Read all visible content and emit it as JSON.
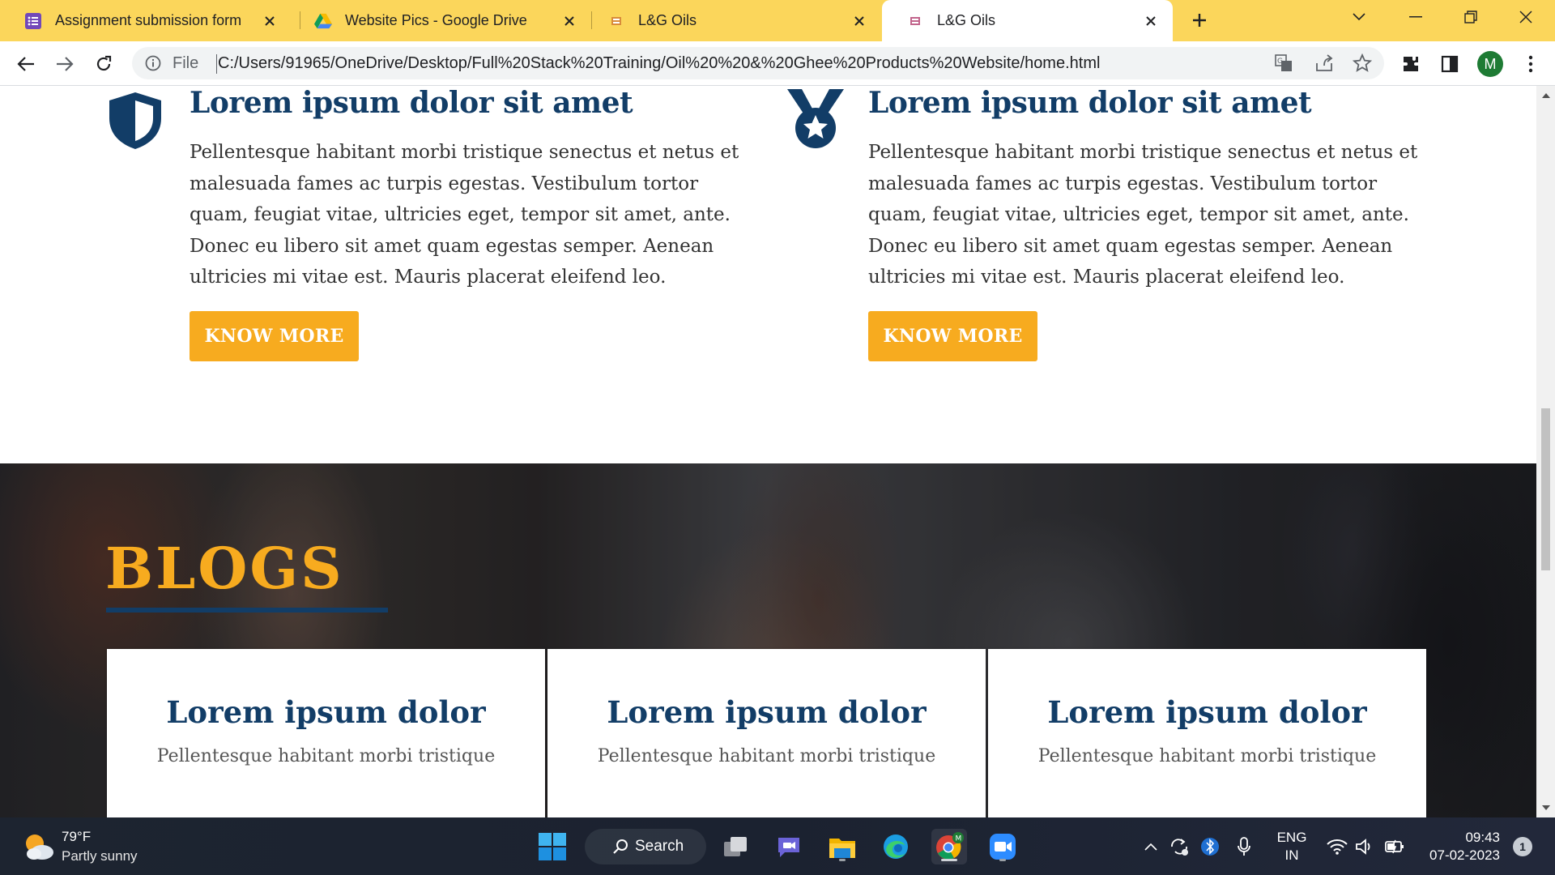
{
  "browser": {
    "tabs": [
      {
        "title": "Assignment submission form",
        "favicon": "google-forms-icon",
        "active": false
      },
      {
        "title": "Website Pics - Google Drive",
        "favicon": "google-drive-icon",
        "active": false
      },
      {
        "title": "L&G Oils",
        "favicon": "site-favicon-icon",
        "active": false
      },
      {
        "title": "L&G Oils",
        "favicon": "site-favicon-icon",
        "active": true
      }
    ],
    "address": {
      "scheme": "File",
      "url": "C:/Users/91965/OneDrive/Desktop/Full%20Stack%20Training/Oil%20%20&%20Ghee%20Products%20Website/home.html"
    },
    "profile_initial": "M"
  },
  "page": {
    "features": [
      {
        "icon": "shield-icon",
        "title": "Lorem ipsum dolor sit amet",
        "text": "Pellentesque habitant morbi tristique senectus et netus et malesuada fames ac turpis egestas. Vestibulum tortor quam, feugiat vitae, ultricies eget, tempor sit amet, ante. Donec eu libero sit amet quam egestas semper. Aenean ultricies mi vitae est. Mauris placerat eleifend leo.",
        "button": "KNOW MORE"
      },
      {
        "icon": "medal-icon",
        "title": "Lorem ipsum dolor sit amet",
        "text": "Pellentesque habitant morbi tristique senectus et netus et malesuada fames ac turpis egestas. Vestibulum tortor quam, feugiat vitae, ultricies eget, tempor sit amet, ante. Donec eu libero sit amet quam egestas semper. Aenean ultricies mi vitae est. Mauris placerat eleifend leo.",
        "button": "KNOW MORE"
      }
    ],
    "blogs": {
      "heading": "BLOGS",
      "cards": [
        {
          "title": "Lorem ipsum dolor",
          "text": "Pellentesque habitant morbi tristique"
        },
        {
          "title": "Lorem ipsum dolor",
          "text": "Pellentesque habitant morbi tristique"
        },
        {
          "title": "Lorem ipsum dolor",
          "text": "Pellentesque habitant morbi tristique"
        }
      ]
    }
  },
  "taskbar": {
    "weather": {
      "temp": "79°F",
      "desc": "Partly sunny"
    },
    "search_label": "Search",
    "language": {
      "line1": "ENG",
      "line2": "IN"
    },
    "clock": {
      "time": "09:43",
      "date": "07-02-2023"
    },
    "notification_count": "1"
  },
  "colors": {
    "tabstrip": "#fbd65b",
    "navy": "#123d67",
    "accent": "#f7ab1f"
  }
}
